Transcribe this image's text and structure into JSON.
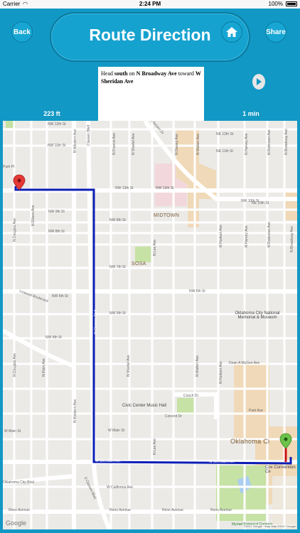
{
  "status_bar": {
    "carrier": "Carrier",
    "time": "2:24 PM",
    "battery": "100%"
  },
  "header": {
    "title": "Route Direction",
    "back_label": "Back",
    "share_label": "Share",
    "home_icon": "home-icon"
  },
  "instruction": {
    "prefix": "Head ",
    "direction": "south",
    "mid": " on ",
    "road": "N Broadway Ave",
    "toward": " toward ",
    "destination": "W Sheridan Ave"
  },
  "summary": {
    "distance": "223 ft",
    "duration": "1 min"
  },
  "map": {
    "districts": [
      "MIDTOWN",
      "SOSA",
      "Oklahoma Ci"
    ],
    "pois": [
      "Oklahoma City National Memorial & Museum",
      "Civic Center Music Hall",
      "Cox Convention Ce",
      "Myriad Botanical Gardens"
    ],
    "street_labels_h": [
      "NW 12th St",
      "NW 11th St",
      "NW 13th St",
      "NW 13th St",
      "NW 10th St",
      "NW 9th St",
      "NW 8th St",
      "NW 8th St",
      "NW 7th St",
      "NW 6th St",
      "NW 6th St",
      "NW 5th St",
      "NW 4th St",
      "Couch Dr",
      "Colcord Dr",
      "W Main St",
      "W Main St",
      "W California Ave",
      "Reno Avenue",
      "Reno Avenue",
      "Reno Avenue",
      "Reno Avenue",
      "Park Ave",
      "Dean A McGee Ave",
      "Park Pl",
      "Classen Dr",
      "W Sheridan Ave",
      "W Sheridan Ave",
      "Oklahoma City Blvd",
      "Linwood Boulevard",
      "NE 12th St",
      "NE 11th St",
      "NE 10th St"
    ],
    "street_labels_v": [
      "N Western Ave",
      "N Western Ave",
      "N Douglas Ave",
      "N Douglas Ave",
      "N Ellison Ave",
      "N Klein Ave",
      "N Francis Ave",
      "N Shartel Ave",
      "N Shartel Ave",
      "N Lee Ave",
      "N Lee Ave",
      "N Dewey Ave",
      "N Walker Ave",
      "N Walker Ave",
      "N Hudson Ave",
      "N Hudson Ave",
      "N Harvey Ave",
      "N Harvey Ave",
      "N Robinson Ave",
      "N Robinson Ave",
      "N Broadway Ave",
      "N Broadway Ave",
      "Classen Blvd",
      "N Classen Blvd",
      "S Classen Blvd"
    ],
    "google": "Google",
    "copyright": "©2017 Google · Map data ©2017 Google"
  },
  "colors": {
    "header_bg": "#1298c4",
    "route": "#0c1eb4",
    "route_end": "#cc1111"
  }
}
